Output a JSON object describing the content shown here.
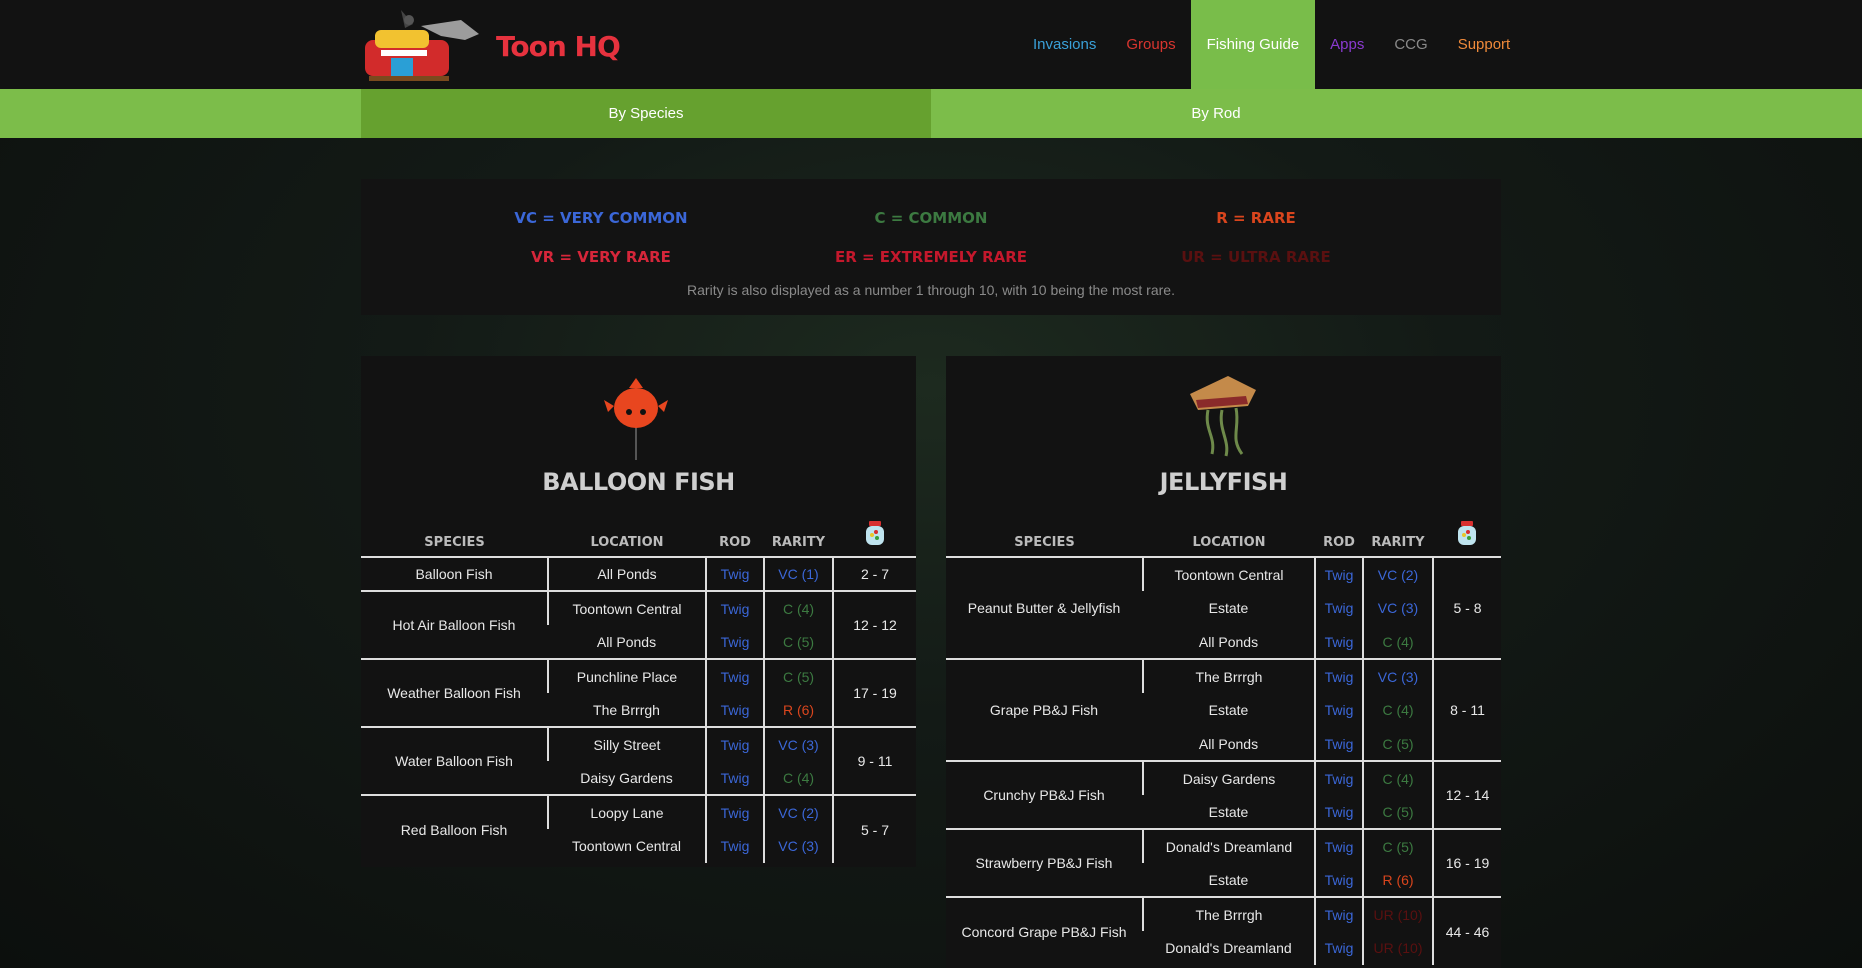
{
  "header": {
    "brand": "Toon HQ",
    "nav": [
      {
        "label": "Invasions",
        "color": "#3aa0d8"
      },
      {
        "label": "Groups",
        "color": "#d7352f"
      },
      {
        "label": "Fishing Guide",
        "color": "#ffffff",
        "active": true
      },
      {
        "label": "Apps",
        "color": "#8a3ad0"
      },
      {
        "label": "CCG",
        "color": "#8a8a8a"
      },
      {
        "label": "Support",
        "color": "#f08a3a"
      }
    ]
  },
  "subnav": {
    "by_species": "By Species",
    "by_rod": "By Rod"
  },
  "legend": {
    "vc": "VC = VERY COMMON",
    "c": "C = COMMON",
    "r": "R = RARE",
    "vr": "VR = VERY RARE",
    "er": "ER = EXTREMELY RARE",
    "ur": "UR = ULTRA RARE",
    "note": "Rarity is also displayed as a number 1 through 10, with 10 being the most rare.",
    "colors": {
      "vc": "#3b67d8",
      "c": "#3c7a41",
      "r": "#d9451d",
      "vr": "#d6263a",
      "er": "#c4182c",
      "ur": "#5a1010"
    }
  },
  "columns": {
    "species": "SPECIES",
    "location": "LOCATION",
    "rod": "ROD",
    "rarity": "RARITY",
    "jar": "jellybean-jar-icon"
  },
  "balloon": {
    "title": "BALLOON FISH",
    "icon": "balloon-fish-icon",
    "rows": [
      {
        "species": "Balloon Fish",
        "jellybeans": "2 - 7",
        "spots": [
          {
            "location": "All Ponds",
            "rod": "Twig",
            "rarity": "VC (1)",
            "cls": "vc"
          }
        ]
      },
      {
        "species": "Hot Air Balloon Fish",
        "jellybeans": "12 - 12",
        "spots": [
          {
            "location": "Toontown Central",
            "rod": "Twig",
            "rarity": "C (4)",
            "cls": "c"
          },
          {
            "location": "All Ponds",
            "rod": "Twig",
            "rarity": "C (5)",
            "cls": "c"
          }
        ]
      },
      {
        "species": "Weather Balloon Fish",
        "jellybeans": "17 - 19",
        "spots": [
          {
            "location": "Punchline Place",
            "rod": "Twig",
            "rarity": "C (5)",
            "cls": "c"
          },
          {
            "location": "The Brrrgh",
            "rod": "Twig",
            "rarity": "R (6)",
            "cls": "r"
          }
        ]
      },
      {
        "species": "Water Balloon Fish",
        "jellybeans": "9 - 11",
        "spots": [
          {
            "location": "Silly Street",
            "rod": "Twig",
            "rarity": "VC (3)",
            "cls": "vc"
          },
          {
            "location": "Daisy Gardens",
            "rod": "Twig",
            "rarity": "C (4)",
            "cls": "c"
          }
        ]
      },
      {
        "species": "Red Balloon Fish",
        "jellybeans": "5 - 7",
        "spots": [
          {
            "location": "Loopy Lane",
            "rod": "Twig",
            "rarity": "VC (2)",
            "cls": "vc"
          },
          {
            "location": "Toontown Central",
            "rod": "Twig",
            "rarity": "VC (3)",
            "cls": "vc"
          }
        ]
      }
    ]
  },
  "jelly": {
    "title": "JELLYFISH",
    "icon": "jellyfish-icon",
    "rows": [
      {
        "species": "Peanut Butter & Jellyfish",
        "jellybeans": "5 - 8",
        "spots": [
          {
            "location": "Toontown Central",
            "rod": "Twig",
            "rarity": "VC (2)",
            "cls": "vc"
          },
          {
            "location": "Estate",
            "rod": "Twig",
            "rarity": "VC (3)",
            "cls": "vc"
          },
          {
            "location": "All Ponds",
            "rod": "Twig",
            "rarity": "C (4)",
            "cls": "c"
          }
        ]
      },
      {
        "species": "Grape PB&J Fish",
        "jellybeans": "8 - 11",
        "spots": [
          {
            "location": "The Brrrgh",
            "rod": "Twig",
            "rarity": "VC (3)",
            "cls": "vc"
          },
          {
            "location": "Estate",
            "rod": "Twig",
            "rarity": "C (4)",
            "cls": "c"
          },
          {
            "location": "All Ponds",
            "rod": "Twig",
            "rarity": "C (5)",
            "cls": "c"
          }
        ]
      },
      {
        "species": "Crunchy PB&J Fish",
        "jellybeans": "12 - 14",
        "spots": [
          {
            "location": "Daisy Gardens",
            "rod": "Twig",
            "rarity": "C (4)",
            "cls": "c"
          },
          {
            "location": "Estate",
            "rod": "Twig",
            "rarity": "C (5)",
            "cls": "c"
          }
        ]
      },
      {
        "species": "Strawberry PB&J Fish",
        "jellybeans": "16 - 19",
        "spots": [
          {
            "location": "Donald's Dreamland",
            "rod": "Twig",
            "rarity": "C (5)",
            "cls": "c"
          },
          {
            "location": "Estate",
            "rod": "Twig",
            "rarity": "R (6)",
            "cls": "r"
          }
        ]
      },
      {
        "species": "Concord Grape PB&J Fish",
        "jellybeans": "44 - 46",
        "spots": [
          {
            "location": "The Brrrgh",
            "rod": "Twig",
            "rarity": "UR (10)",
            "cls": "ur"
          },
          {
            "location": "Donald's Dreamland",
            "rod": "Twig",
            "rarity": "UR (10)",
            "cls": "ur"
          }
        ]
      }
    ]
  }
}
